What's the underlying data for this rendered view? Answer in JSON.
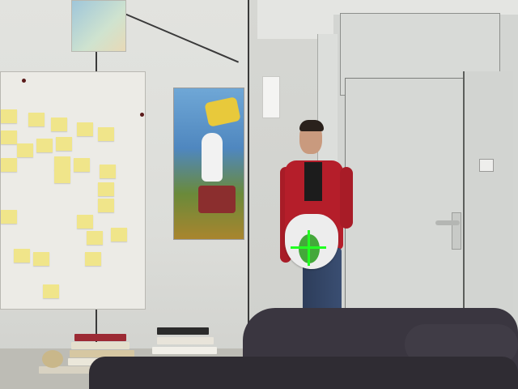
{
  "scene": {
    "description_visible_text": "",
    "colors": {
      "wall": "#dcddd9",
      "sticky_note": "#f0e58a",
      "red_cardigan": "#b51e2a",
      "sofa": "#3a3640",
      "tracker_crosshair": "#22ff22",
      "tracker_target": "#44a83a"
    },
    "sticky_note_count": 24
  }
}
